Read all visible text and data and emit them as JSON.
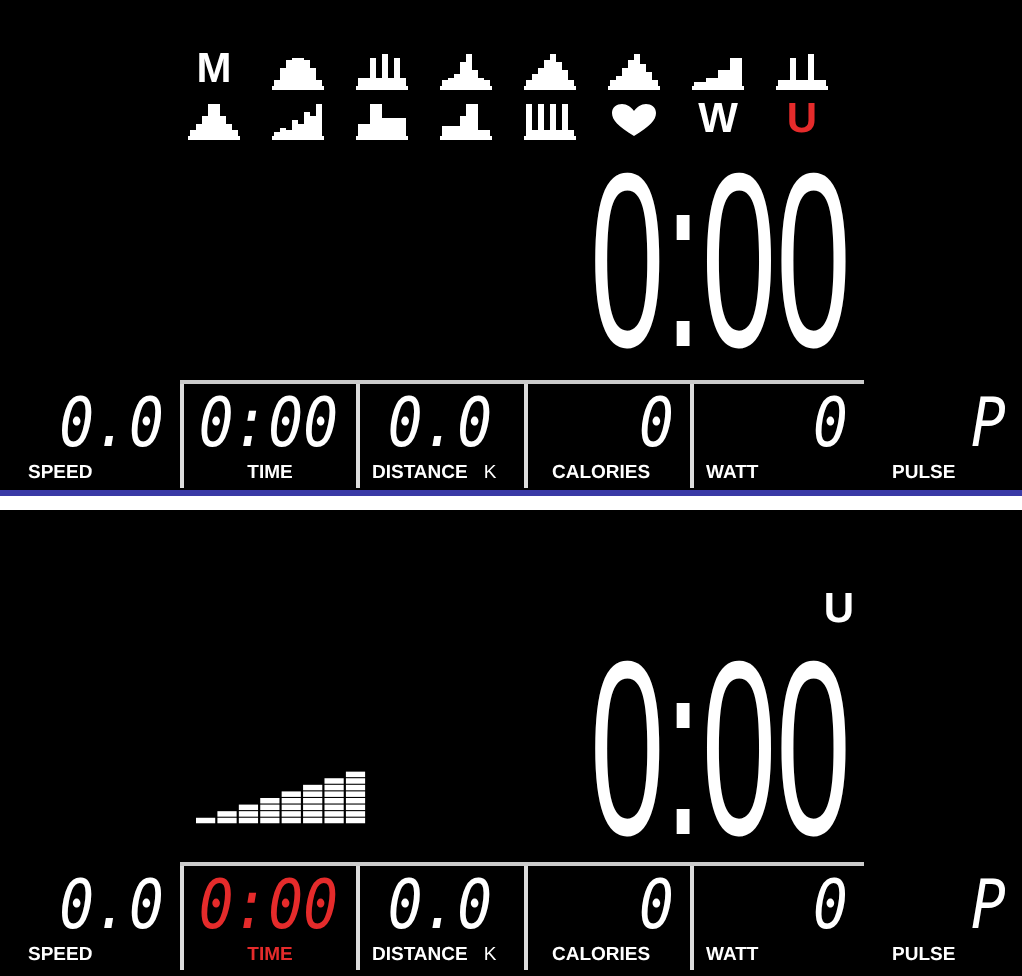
{
  "panel_1": {
    "programs": [
      {
        "kind": "letter",
        "label": "M",
        "selected": false
      },
      {
        "kind": "profile",
        "selected": false
      },
      {
        "kind": "profile",
        "selected": false
      },
      {
        "kind": "profile",
        "selected": false
      },
      {
        "kind": "profile",
        "selected": false
      },
      {
        "kind": "profile",
        "selected": false
      },
      {
        "kind": "profile",
        "selected": false
      },
      {
        "kind": "profile",
        "selected": false
      },
      {
        "kind": "profile",
        "selected": false
      },
      {
        "kind": "profile",
        "selected": false
      },
      {
        "kind": "profile",
        "selected": false
      },
      {
        "kind": "profile",
        "selected": false
      },
      {
        "kind": "profile",
        "selected": false
      },
      {
        "kind": "heart",
        "selected": false
      },
      {
        "kind": "letter",
        "label": "W",
        "selected": false
      },
      {
        "kind": "letter",
        "label": "U",
        "selected": true
      }
    ],
    "clock": "0:00",
    "readouts": [
      {
        "label": "SPEED",
        "value": "0.0",
        "selected": false
      },
      {
        "label": "TIME",
        "value": "0:00",
        "selected": false
      },
      {
        "label": "DISTANCE",
        "unit": "K",
        "value": "0.0",
        "selected": false
      },
      {
        "label": "CALORIES",
        "value": "0",
        "selected": false
      },
      {
        "label": "WATT",
        "value": "0",
        "selected": false
      },
      {
        "label": "PULSE",
        "value": "P",
        "selected": false
      }
    ]
  },
  "panel_2": {
    "program_label": "U",
    "clock": "0:00",
    "readouts": [
      {
        "label": "SPEED",
        "value": "0.0",
        "selected": false
      },
      {
        "label": "TIME",
        "value": "0:00",
        "selected": true
      },
      {
        "label": "DISTANCE",
        "unit": "K",
        "value": "0.0",
        "selected": false
      },
      {
        "label": "CALORIES",
        "value": "0",
        "selected": false
      },
      {
        "label": "WATT",
        "value": "0",
        "selected": false
      },
      {
        "label": "PULSE",
        "value": "P",
        "selected": false
      }
    ]
  }
}
